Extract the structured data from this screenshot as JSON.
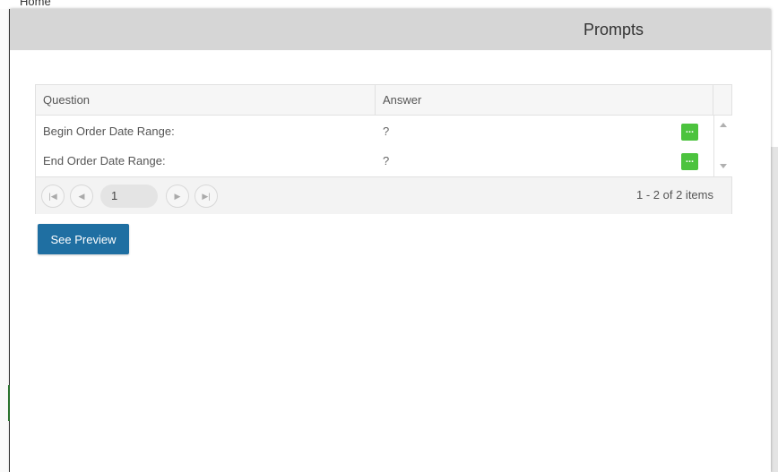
{
  "background": {
    "home_label": "Home"
  },
  "modal": {
    "title": "Prompts"
  },
  "grid": {
    "columns": [
      "Question",
      "Answer"
    ],
    "rows": [
      {
        "question": "Begin Order Date Range:",
        "answer": "?",
        "button_label": "..."
      },
      {
        "question": "End Order Date Range:",
        "answer": "?",
        "button_label": "..."
      }
    ],
    "pager": {
      "current_page": "1",
      "info": "1 - 2 of 2 items"
    }
  },
  "actions": {
    "preview_label": "See Preview"
  },
  "colors": {
    "pick_button": "#4cc33e",
    "primary_button": "#1f6fa2",
    "header": "#d6d6d6"
  }
}
